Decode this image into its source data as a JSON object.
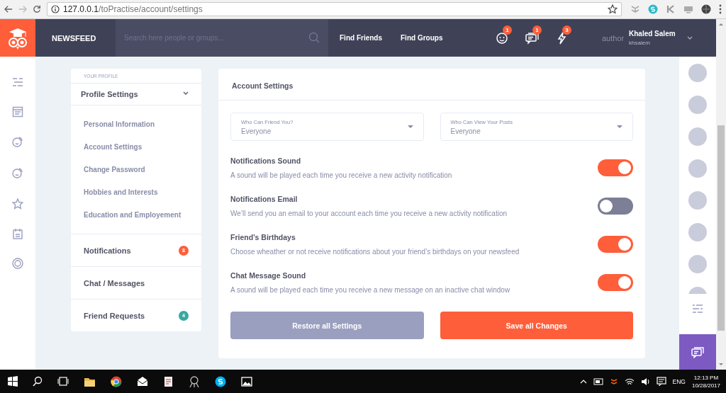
{
  "browser": {
    "url_host": "127.0.0.1",
    "url_path": "/toPractise/account/settings"
  },
  "header": {
    "brand": "NEWSFEED",
    "search": {
      "placeholder": "Search here people or groups..."
    },
    "nav": [
      "Find Friends",
      "Find Groups"
    ],
    "notifications": [
      {
        "kind": "friends",
        "count": "1"
      },
      {
        "kind": "messages",
        "count": "1"
      },
      {
        "kind": "activity",
        "count": "3"
      }
    ],
    "user": {
      "avatar_alt": "author",
      "name": "Khaled Salem",
      "handle": "khsalem"
    }
  },
  "profile_menu": {
    "caption": "YOUR PROFILE",
    "title": "Profile Settings",
    "expanded": true,
    "items": [
      "Personal Information",
      "Account Settings",
      "Change Password",
      "Hobbies and Interests",
      "Education and Employement"
    ],
    "sections": [
      {
        "label": "Notifications",
        "badge": "8",
        "color": "#ff5e3a"
      },
      {
        "label": "Chat / Messages"
      },
      {
        "label": "Friend Requests",
        "badge": "4",
        "color": "#38a9a0"
      }
    ]
  },
  "settings": {
    "title": "Account Settings",
    "selects": [
      {
        "label": "Who Can Friend You?",
        "value": "Everyone"
      },
      {
        "label": "Who Can View Your Posts",
        "value": "Everyone"
      }
    ],
    "toggles": [
      {
        "title": "Notifications Sound",
        "description": "A sound will be played each time you receive a new activity notification",
        "on": true
      },
      {
        "title": "Notifications Email",
        "description": "We’ll send you an email to your account each time you receive a new activity notification",
        "on": false
      },
      {
        "title": "Friend’s Birthdays",
        "description": "Choose wheather or not receive notifications about your friend’s birthdays on your newsfeed",
        "on": true
      },
      {
        "title": "Chat Message Sound",
        "description": "A sound will be played each time you receive a new message on an inactive chat window",
        "on": true
      }
    ],
    "buttons": [
      {
        "label": "Restore all Settings",
        "kind": "secondary"
      },
      {
        "label": "Save all Changes",
        "kind": "primary"
      }
    ]
  },
  "taskbar": {
    "language": "ENG",
    "time": "12:13 PM",
    "date": "10/28/2017"
  }
}
